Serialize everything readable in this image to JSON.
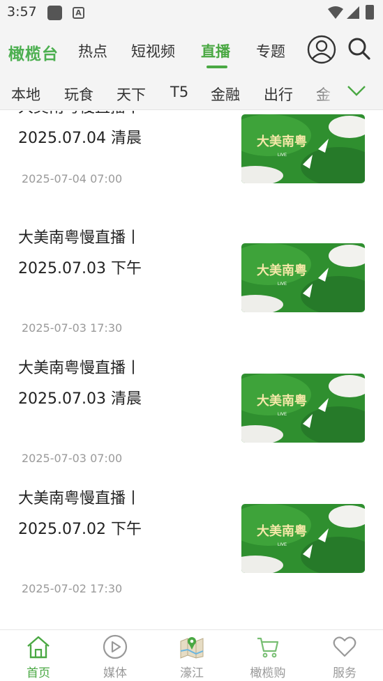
{
  "status_bar": {
    "time": "3:57"
  },
  "top_nav": {
    "brand": "橄榄台",
    "tabs": [
      {
        "label": "热点",
        "active": false
      },
      {
        "label": "短视频",
        "active": false
      },
      {
        "label": "直播",
        "active": true
      },
      {
        "label": "专题",
        "active": false
      }
    ],
    "icons": [
      "user-icon",
      "search-icon"
    ],
    "accent_color": "#4aa843"
  },
  "channels": {
    "items": [
      "本地",
      "玩食",
      "天下",
      "T5",
      "金融",
      "出行",
      "金"
    ]
  },
  "list": {
    "items": [
      {
        "title_line1": "大美南粤慢直播丨",
        "title_line2": "2025.07.04 清晨",
        "date": "2025-07-04 07:00",
        "thumb_title": "大美南粤",
        "thumb_badge": "LIVE"
      },
      {
        "title_line1": "大美南粤慢直播丨",
        "title_line2": "2025.07.03 下午",
        "date": "2025-07-03 17:30",
        "thumb_title": "大美南粤",
        "thumb_badge": "LIVE"
      },
      {
        "title_line1": "大美南粤慢直播丨",
        "title_line2": "2025.07.03 清晨",
        "date": "2025-07-03 07:00",
        "thumb_title": "大美南粤",
        "thumb_badge": "LIVE"
      },
      {
        "title_line1": "大美南粤慢直播丨",
        "title_line2": "2025.07.02 下午",
        "date": "2025-07-02 17:30",
        "thumb_title": "大美南粤",
        "thumb_badge": "LIVE"
      }
    ]
  },
  "bottom_nav": {
    "items": [
      {
        "label": "首页",
        "icon": "home-icon",
        "active": true
      },
      {
        "label": "媒体",
        "icon": "play-circle-icon",
        "active": false
      },
      {
        "label": "濠江",
        "icon": "map-icon",
        "active": false
      },
      {
        "label": "橄榄购",
        "icon": "cart-icon",
        "active": false
      },
      {
        "label": "服务",
        "icon": "heart-icon",
        "active": false
      }
    ]
  }
}
